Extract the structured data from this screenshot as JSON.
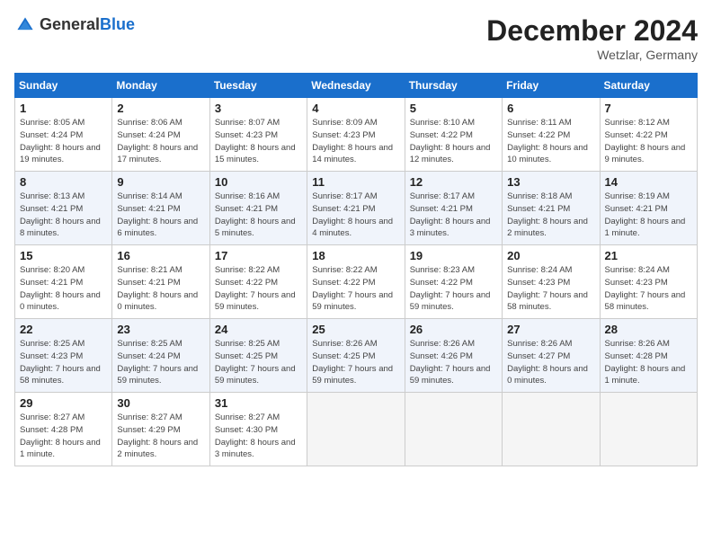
{
  "header": {
    "logo_general": "General",
    "logo_blue": "Blue",
    "title": "December 2024",
    "location": "Wetzlar, Germany"
  },
  "days_of_week": [
    "Sunday",
    "Monday",
    "Tuesday",
    "Wednesday",
    "Thursday",
    "Friday",
    "Saturday"
  ],
  "weeks": [
    [
      {
        "day": "1",
        "rise": "8:05 AM",
        "set": "4:24 PM",
        "daylight": "8 hours and 19 minutes"
      },
      {
        "day": "2",
        "rise": "8:06 AM",
        "set": "4:24 PM",
        "daylight": "8 hours and 17 minutes"
      },
      {
        "day": "3",
        "rise": "8:07 AM",
        "set": "4:23 PM",
        "daylight": "8 hours and 15 minutes"
      },
      {
        "day": "4",
        "rise": "8:09 AM",
        "set": "4:23 PM",
        "daylight": "8 hours and 14 minutes"
      },
      {
        "day": "5",
        "rise": "8:10 AM",
        "set": "4:22 PM",
        "daylight": "8 hours and 12 minutes"
      },
      {
        "day": "6",
        "rise": "8:11 AM",
        "set": "4:22 PM",
        "daylight": "8 hours and 10 minutes"
      },
      {
        "day": "7",
        "rise": "8:12 AM",
        "set": "4:22 PM",
        "daylight": "8 hours and 9 minutes"
      }
    ],
    [
      {
        "day": "8",
        "rise": "8:13 AM",
        "set": "4:21 PM",
        "daylight": "8 hours and 8 minutes"
      },
      {
        "day": "9",
        "rise": "8:14 AM",
        "set": "4:21 PM",
        "daylight": "8 hours and 6 minutes"
      },
      {
        "day": "10",
        "rise": "8:16 AM",
        "set": "4:21 PM",
        "daylight": "8 hours and 5 minutes"
      },
      {
        "day": "11",
        "rise": "8:17 AM",
        "set": "4:21 PM",
        "daylight": "8 hours and 4 minutes"
      },
      {
        "day": "12",
        "rise": "8:17 AM",
        "set": "4:21 PM",
        "daylight": "8 hours and 3 minutes"
      },
      {
        "day": "13",
        "rise": "8:18 AM",
        "set": "4:21 PM",
        "daylight": "8 hours and 2 minutes"
      },
      {
        "day": "14",
        "rise": "8:19 AM",
        "set": "4:21 PM",
        "daylight": "8 hours and 1 minute"
      }
    ],
    [
      {
        "day": "15",
        "rise": "8:20 AM",
        "set": "4:21 PM",
        "daylight": "8 hours and 0 minutes"
      },
      {
        "day": "16",
        "rise": "8:21 AM",
        "set": "4:21 PM",
        "daylight": "8 hours and 0 minutes"
      },
      {
        "day": "17",
        "rise": "8:22 AM",
        "set": "4:22 PM",
        "daylight": "7 hours and 59 minutes"
      },
      {
        "day": "18",
        "rise": "8:22 AM",
        "set": "4:22 PM",
        "daylight": "7 hours and 59 minutes"
      },
      {
        "day": "19",
        "rise": "8:23 AM",
        "set": "4:22 PM",
        "daylight": "7 hours and 59 minutes"
      },
      {
        "day": "20",
        "rise": "8:24 AM",
        "set": "4:23 PM",
        "daylight": "7 hours and 58 minutes"
      },
      {
        "day": "21",
        "rise": "8:24 AM",
        "set": "4:23 PM",
        "daylight": "7 hours and 58 minutes"
      }
    ],
    [
      {
        "day": "22",
        "rise": "8:25 AM",
        "set": "4:23 PM",
        "daylight": "7 hours and 58 minutes"
      },
      {
        "day": "23",
        "rise": "8:25 AM",
        "set": "4:24 PM",
        "daylight": "7 hours and 59 minutes"
      },
      {
        "day": "24",
        "rise": "8:25 AM",
        "set": "4:25 PM",
        "daylight": "7 hours and 59 minutes"
      },
      {
        "day": "25",
        "rise": "8:26 AM",
        "set": "4:25 PM",
        "daylight": "7 hours and 59 minutes"
      },
      {
        "day": "26",
        "rise": "8:26 AM",
        "set": "4:26 PM",
        "daylight": "7 hours and 59 minutes"
      },
      {
        "day": "27",
        "rise": "8:26 AM",
        "set": "4:27 PM",
        "daylight": "8 hours and 0 minutes"
      },
      {
        "day": "28",
        "rise": "8:26 AM",
        "set": "4:28 PM",
        "daylight": "8 hours and 1 minute"
      }
    ],
    [
      {
        "day": "29",
        "rise": "8:27 AM",
        "set": "4:28 PM",
        "daylight": "8 hours and 1 minute"
      },
      {
        "day": "30",
        "rise": "8:27 AM",
        "set": "4:29 PM",
        "daylight": "8 hours and 2 minutes"
      },
      {
        "day": "31",
        "rise": "8:27 AM",
        "set": "4:30 PM",
        "daylight": "8 hours and 3 minutes"
      },
      null,
      null,
      null,
      null
    ]
  ]
}
